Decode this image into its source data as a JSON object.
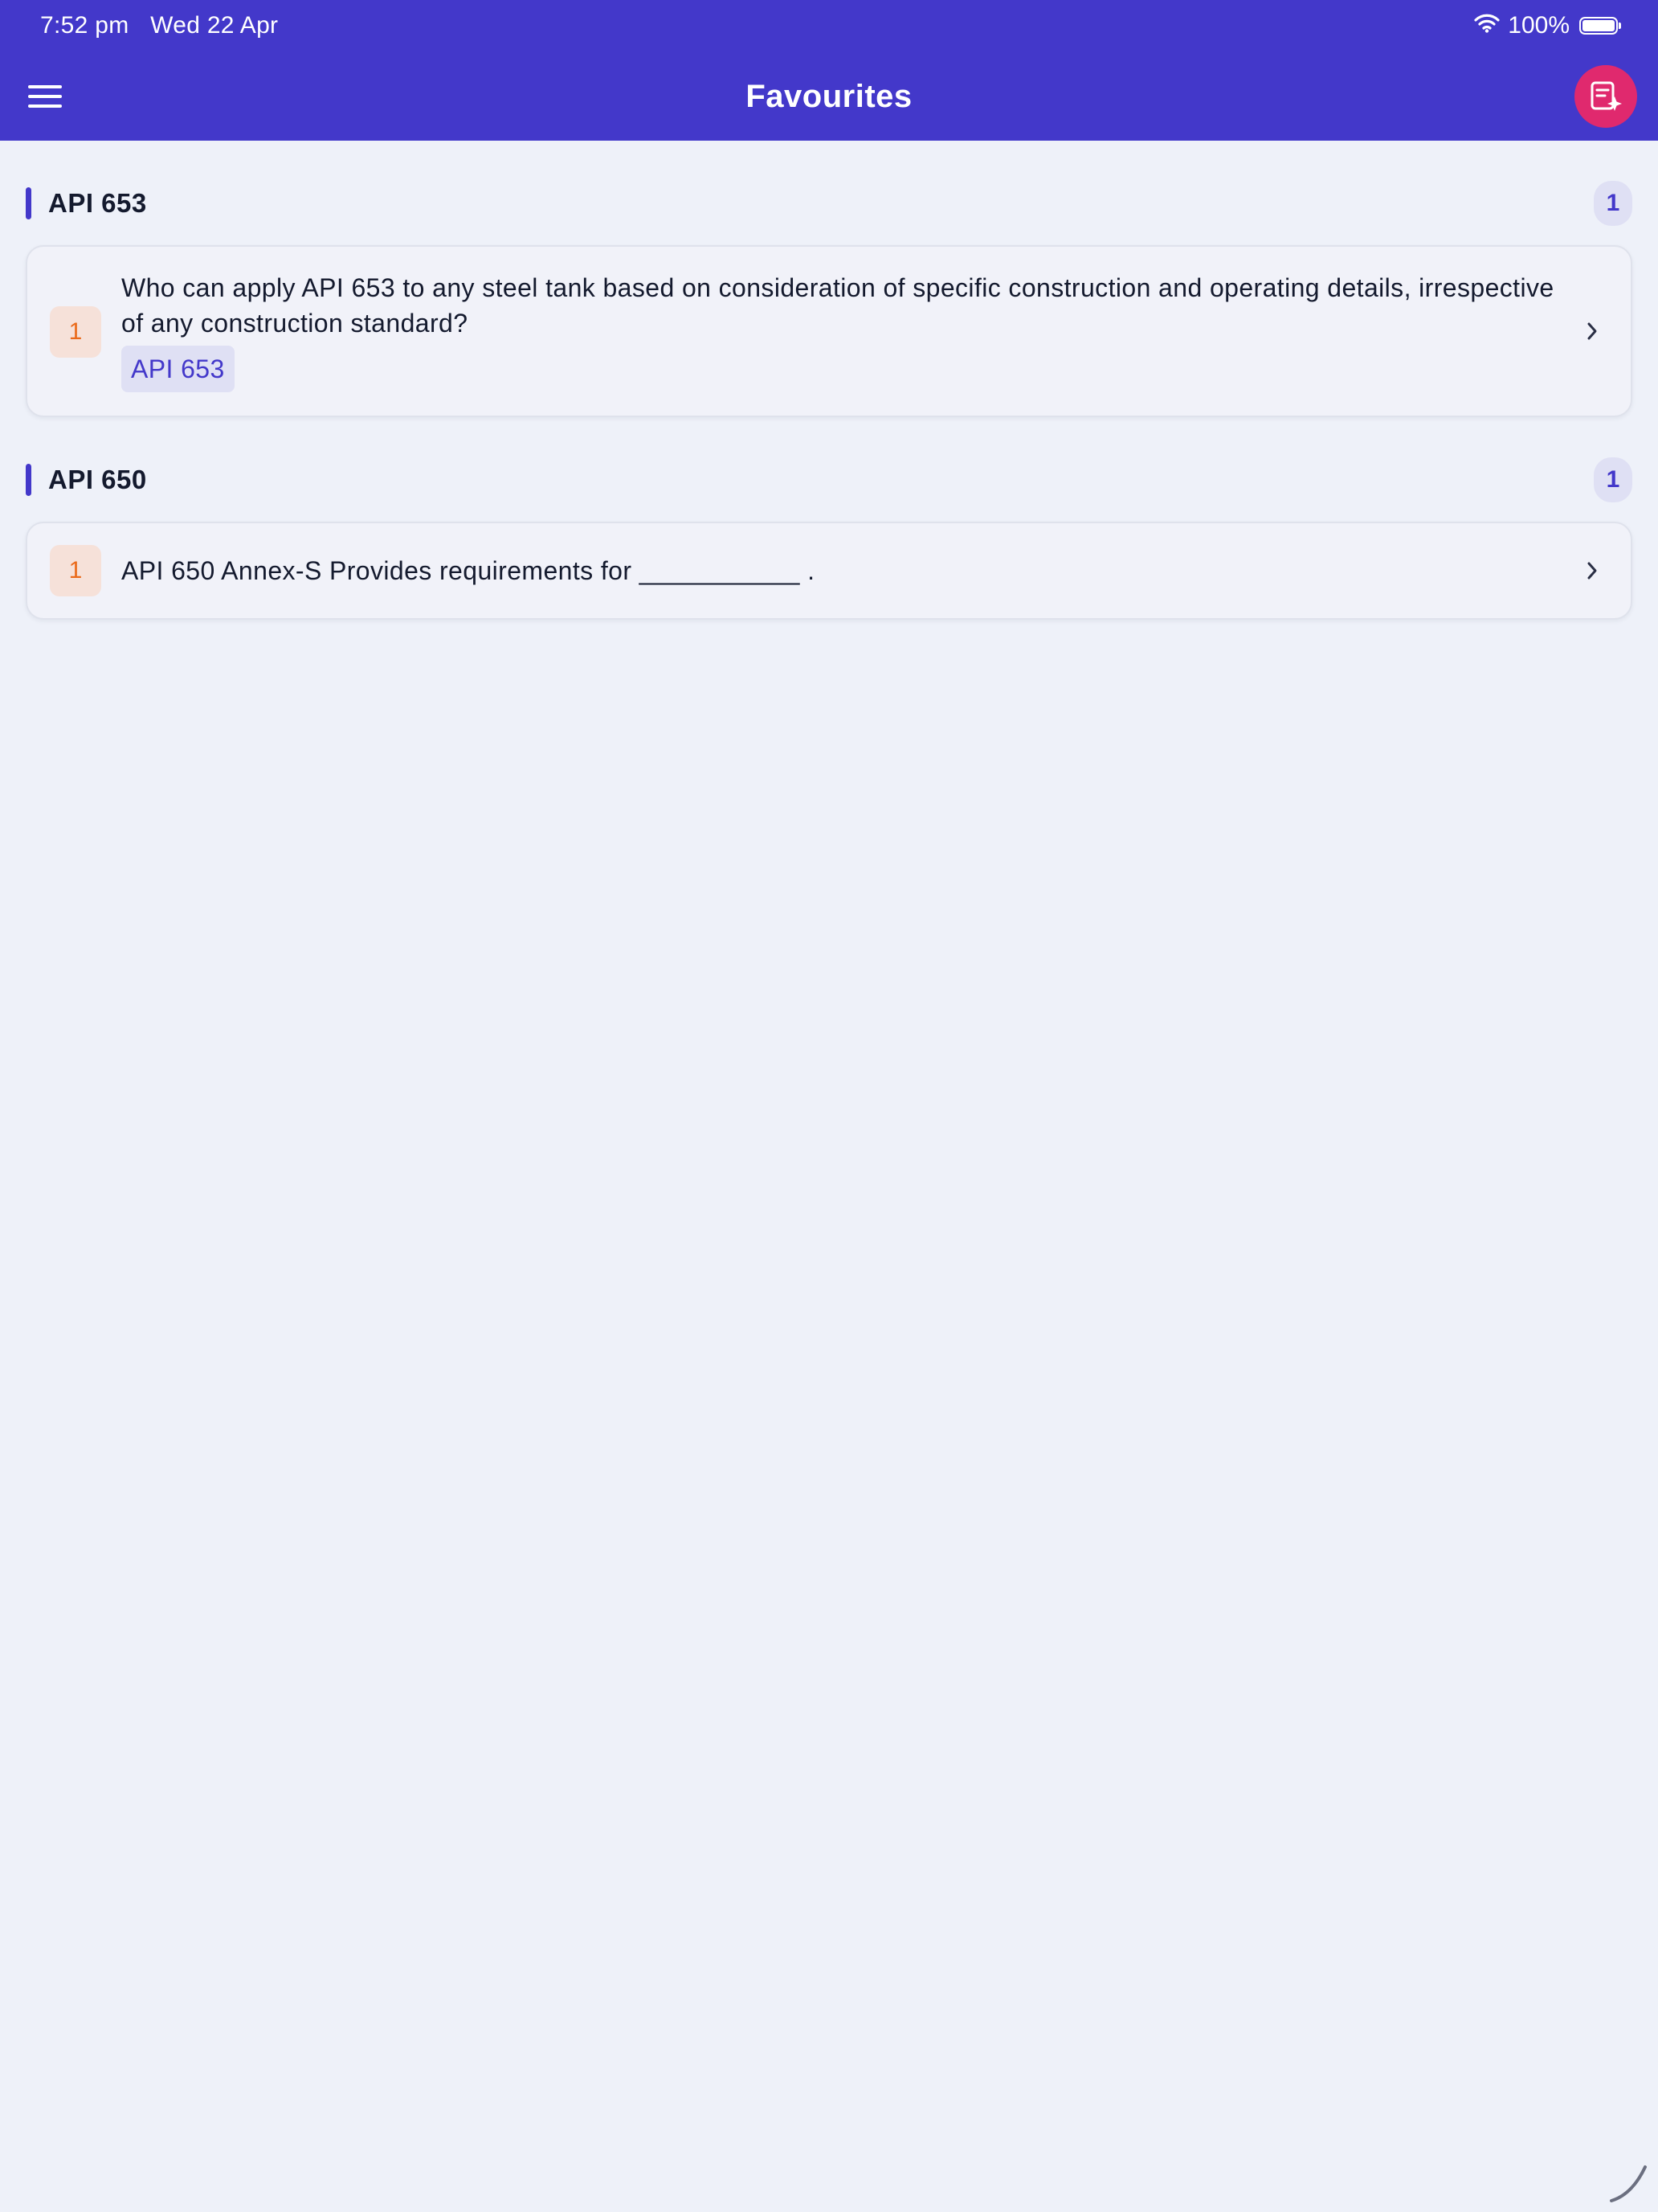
{
  "status_bar": {
    "time": "7:52 pm",
    "date": "Wed 22 Apr",
    "battery_percent": "100%"
  },
  "header": {
    "title": "Favourites",
    "menu_icon": "hamburger-menu-icon",
    "action_icon": "note-sparkle-icon",
    "action_color": "#e0296e",
    "bar_color": "#4338ca"
  },
  "sections": [
    {
      "title": "API 653",
      "count": "1",
      "items": [
        {
          "number": "1",
          "question": "Who can apply API 653 to any steel tank based on consideration of specific construction and operating details, irrespective of any construction standard?",
          "tag": "API 653"
        }
      ]
    },
    {
      "title": "API 650",
      "count": "1",
      "items": [
        {
          "number": "1",
          "question": "API 650 Annex-S Provides requirements for ___________ ."
        }
      ]
    }
  ]
}
